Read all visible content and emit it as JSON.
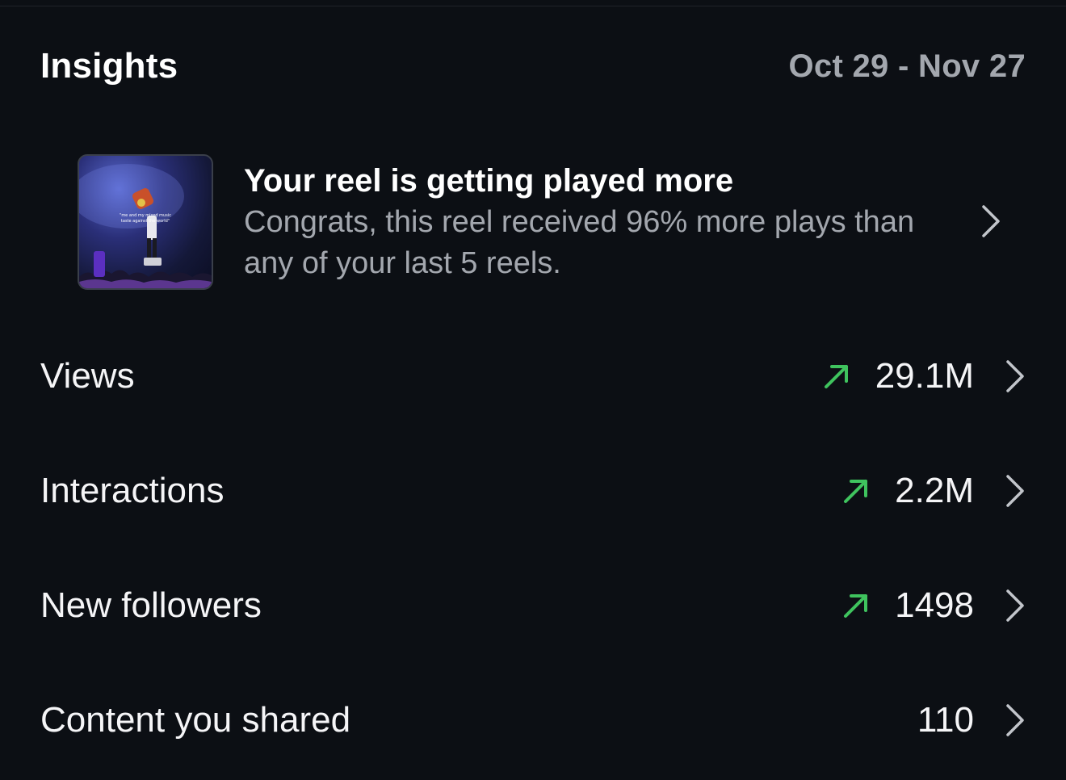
{
  "header": {
    "title": "Insights",
    "date_range": "Oct 29 - Nov 27"
  },
  "reel_card": {
    "title": "Your reel is getting played more",
    "description": "Congrats, this reel received 96% more plays than any of your last 5 reels.",
    "thumbnail_caption": "\"me and my mixed music taste against the world\""
  },
  "metrics": [
    {
      "label": "Views",
      "value": "29.1M",
      "trend": "up"
    },
    {
      "label": "Interactions",
      "value": "2.2M",
      "trend": "up"
    },
    {
      "label": "New followers",
      "value": "1498",
      "trend": "up"
    },
    {
      "label": "Content you shared",
      "value": "110",
      "trend": "none"
    }
  ],
  "icons": {
    "trend": "arrow-up-right-icon",
    "chevron": "chevron-right-icon"
  },
  "colors": {
    "background": "#0c0f14",
    "trend_up": "#3fc35e",
    "secondary_text": "#a3a7ae"
  }
}
